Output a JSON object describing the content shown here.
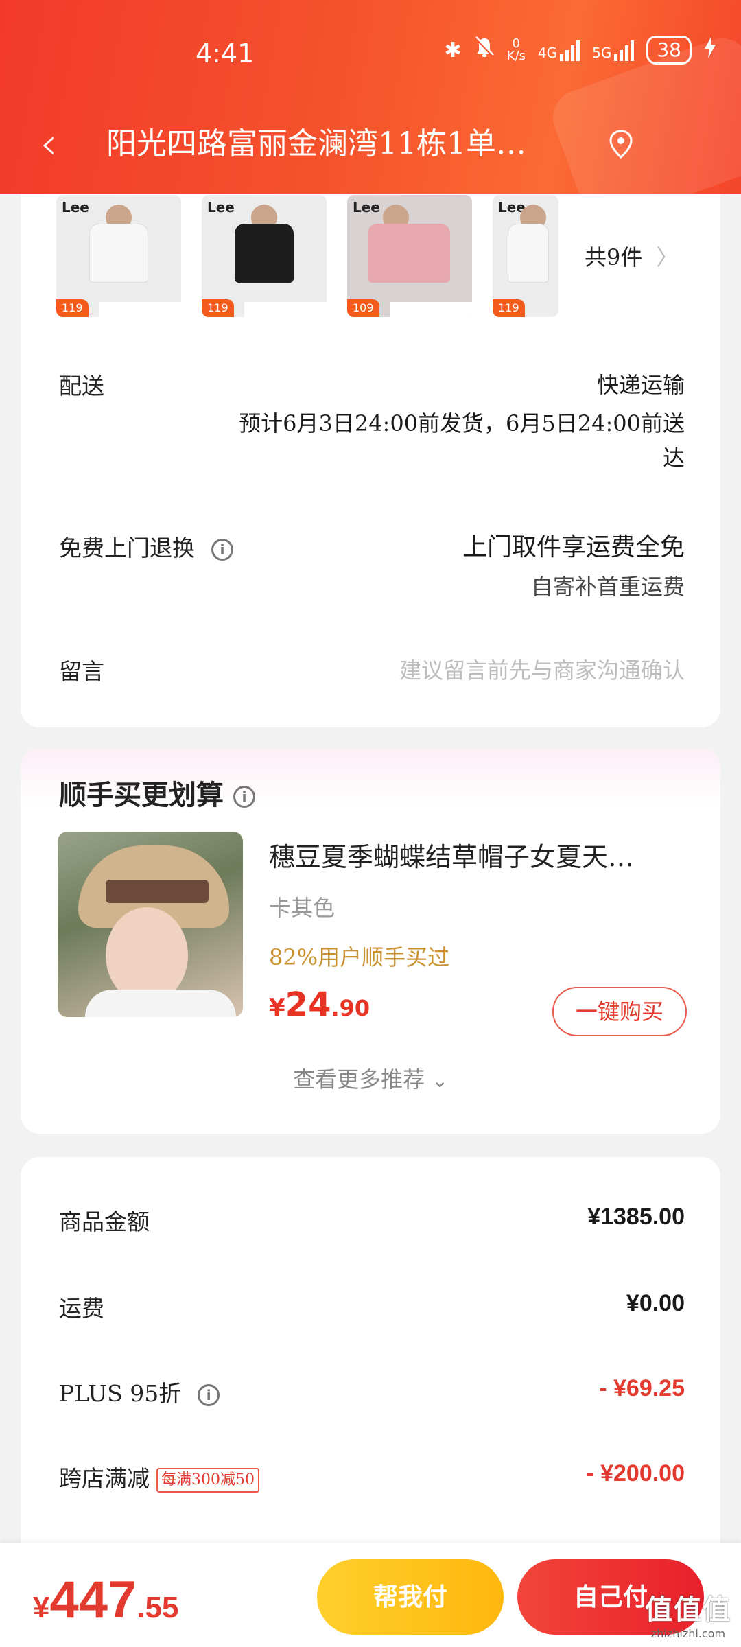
{
  "status_bar": {
    "time": "4:41",
    "net_speed_value": "0",
    "net_speed_unit": "K/s",
    "signal1": "4G",
    "signal2": "5G",
    "battery": "38"
  },
  "header": {
    "address": "阳光四路富丽金澜湾11栋1单…"
  },
  "items": {
    "thumbnails": [
      {
        "logo": "Lee",
        "price": "119",
        "color": "#f7f7f7"
      },
      {
        "logo": "Lee",
        "price": "119",
        "color": "#1d1d1d"
      },
      {
        "logo": "Lee",
        "price": "109",
        "color": "#e7a8ad"
      },
      {
        "logo": "Lee",
        "price": "119",
        "color": "#f7f7f7"
      }
    ],
    "count_label": "共9件",
    "chevron": "〉"
  },
  "delivery": {
    "label": "配送",
    "method": "快递运输",
    "estimate_line1": "预计6月3日24:00前发货，6月5日24:00前送",
    "estimate_line2": "达"
  },
  "returns": {
    "label": "免费上门退换",
    "info_icon": "i",
    "main": "上门取件享运费全免",
    "sub": "自寄补首重运费"
  },
  "message": {
    "label": "留言",
    "placeholder": "建议留言前先与商家沟通确认"
  },
  "upsell": {
    "title": "顺手买更划算",
    "info_icon": "i",
    "product_name": "穗豆夏季蝴蝶结草帽子女夏天…",
    "color": "卡其色",
    "note": "82%用户顺手买过",
    "price_symbol": "¥",
    "price_int": "24",
    "price_dec": ".90",
    "buy_label": "一键购买",
    "more_label": "查看更多推荐",
    "more_chevron": "⌄"
  },
  "summary": {
    "rows": [
      {
        "label": "商品金额",
        "value": "¥1385.00"
      },
      {
        "label": "运费",
        "value": "¥0.00"
      },
      {
        "label": "PLUS 95折",
        "value": "- ¥69.25"
      },
      {
        "label": "跨店满减",
        "tag": "每满300减50",
        "value": "- ¥200.00"
      }
    ]
  },
  "bottom_bar": {
    "total_symbol": "¥",
    "total_int": "447",
    "total_dec": ".55",
    "help_pay": "帮我付",
    "self_pay": "自己付"
  },
  "watermark": {
    "text": "值值值",
    "site": "zhizhizhi.com"
  },
  "colors": {
    "brand_red": "#e23a2e",
    "header_orange": "#f5522c",
    "help_yellow": "#ffc01e",
    "note_gold": "#c9922f"
  }
}
